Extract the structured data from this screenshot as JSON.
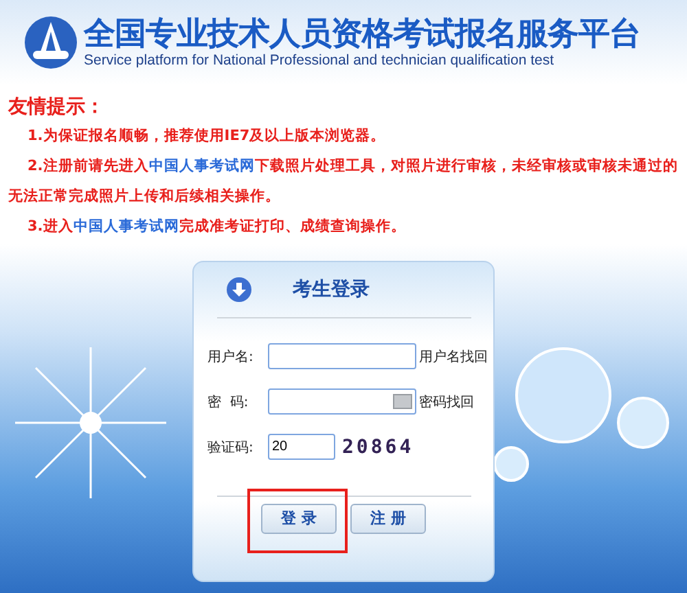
{
  "header": {
    "title": "全国专业技术人员资格考试报名服务平台",
    "subtitle": "Service platform for National Professional and technician qualification test"
  },
  "notice": {
    "heading": "友情提示：",
    "items": [
      {
        "parts": [
          {
            "text": "1.为保证报名顺畅，推荐使用IE7及以上版本浏览器。",
            "kind": "text"
          }
        ]
      },
      {
        "parts": [
          {
            "text": "2.注册前请先进入",
            "kind": "text"
          },
          {
            "text": "中国人事考试网",
            "kind": "link"
          },
          {
            "text": "下载照片处理工具，对照片进行审核，未经审核或审核未通过的无法正常完成照片上传和后续相关操作。",
            "kind": "text"
          }
        ]
      },
      {
        "parts": [
          {
            "text": "3.进入",
            "kind": "text"
          },
          {
            "text": "中国人事考试网",
            "kind": "link"
          },
          {
            "text": "完成准考证打印、成绩查询操作。",
            "kind": "text"
          }
        ]
      }
    ]
  },
  "login": {
    "title": "考生登录",
    "fields": [
      {
        "label": "用户名:",
        "kind": "text",
        "link": "用户名找回"
      },
      {
        "label": "密  码:",
        "kind": "password",
        "link": "密码找回"
      },
      {
        "label": "验证码:",
        "value": "20",
        "kind": "captcha",
        "captcha": "20864"
      }
    ],
    "buttons": [
      {
        "label": "登录",
        "highlighted": true
      },
      {
        "label": "注册",
        "highlighted": false
      }
    ]
  }
}
